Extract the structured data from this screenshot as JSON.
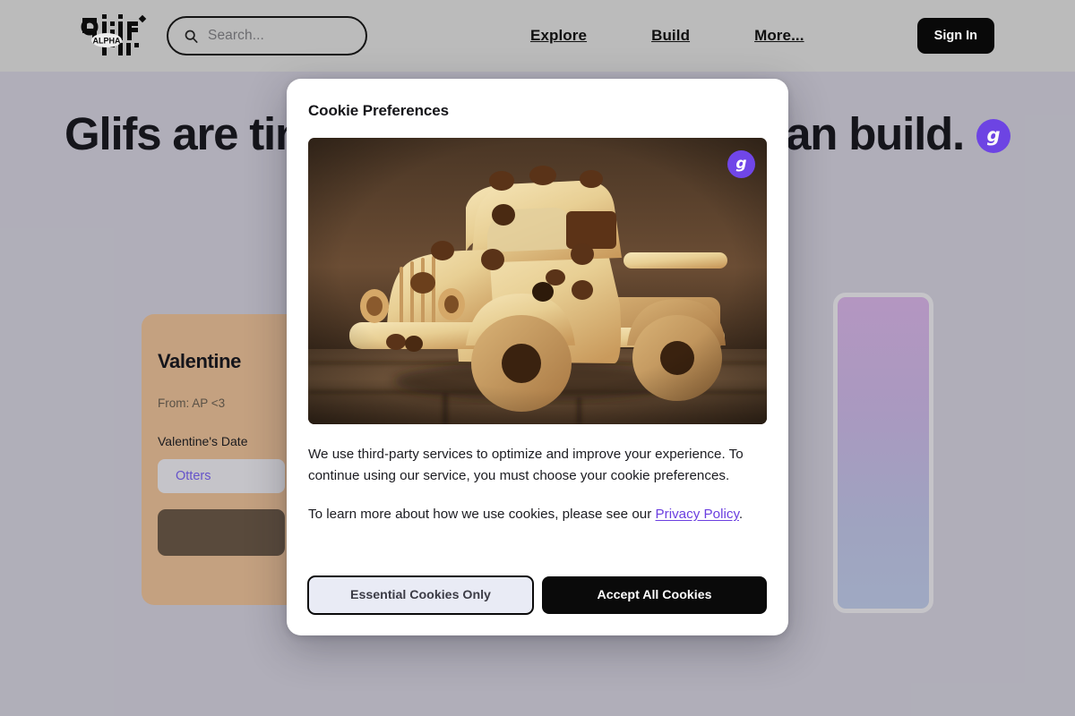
{
  "header": {
    "logo_alt": "glif",
    "logo_badge": "ALPHA",
    "search": {
      "placeholder": "Search...",
      "value": "",
      "icon": "search-icon"
    },
    "nav": [
      {
        "label": "Explore"
      },
      {
        "label": "Build"
      },
      {
        "label": "More..."
      }
    ],
    "signin_label": "Sign In"
  },
  "hero": {
    "headline": "Glifs are tiny AI apps that anyone can build.",
    "badge_glyph": "g",
    "badge_color": "#7046e8"
  },
  "cards": {
    "valentine": {
      "title": "Valentine",
      "from": "From: AP <3",
      "field_label": "Valentine's Date",
      "input_value": "Otters",
      "bg_color": "#c8a583",
      "button_color": "#5b4c3e"
    },
    "gradient": {
      "gradient_from": "#b89ac5",
      "gradient_to": "#a3adc6"
    }
  },
  "modal": {
    "title": "Cookie Preferences",
    "image_alt": "Cookie truck made of cookies on a wooden table",
    "image_badge_glyph": "g",
    "body_paragraph_1": "We use third-party services to optimize and improve your experience. To continue using our service, you must choose your cookie preferences.",
    "body_paragraph_2_prefix": "To learn more about how we use cookies, please see our ",
    "privacy_policy_label": "Privacy Policy",
    "body_paragraph_2_suffix": ".",
    "essential_button_label": "Essential Cookies Only",
    "accept_button_label": "Accept All Cookies",
    "accent_link_color": "#6b3fe0"
  }
}
